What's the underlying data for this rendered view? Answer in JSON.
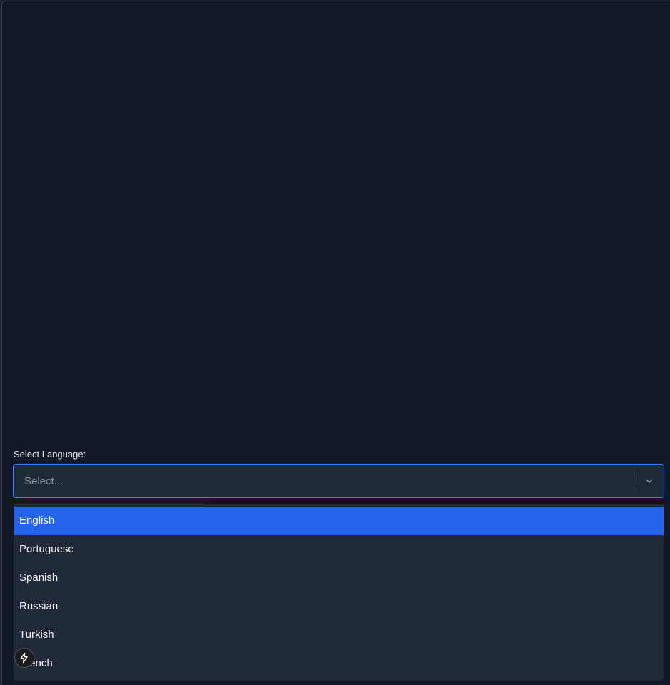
{
  "form": {
    "label": "Select Language:",
    "placeholder": "Select..."
  },
  "menu": {
    "options": [
      {
        "label": "English",
        "focused": true
      },
      {
        "label": "Portuguese"
      },
      {
        "label": "Spanish"
      },
      {
        "label": "Russian"
      },
      {
        "label": "Turkish"
      },
      {
        "label": "French"
      }
    ]
  },
  "icons": {
    "dropdown": "chevron-down-icon",
    "badge": "lightning-icon"
  },
  "colors": {
    "background": "#111827",
    "control": "#1f2937",
    "focus_border": "#3b82f6",
    "option_focused": "#2563eb"
  }
}
